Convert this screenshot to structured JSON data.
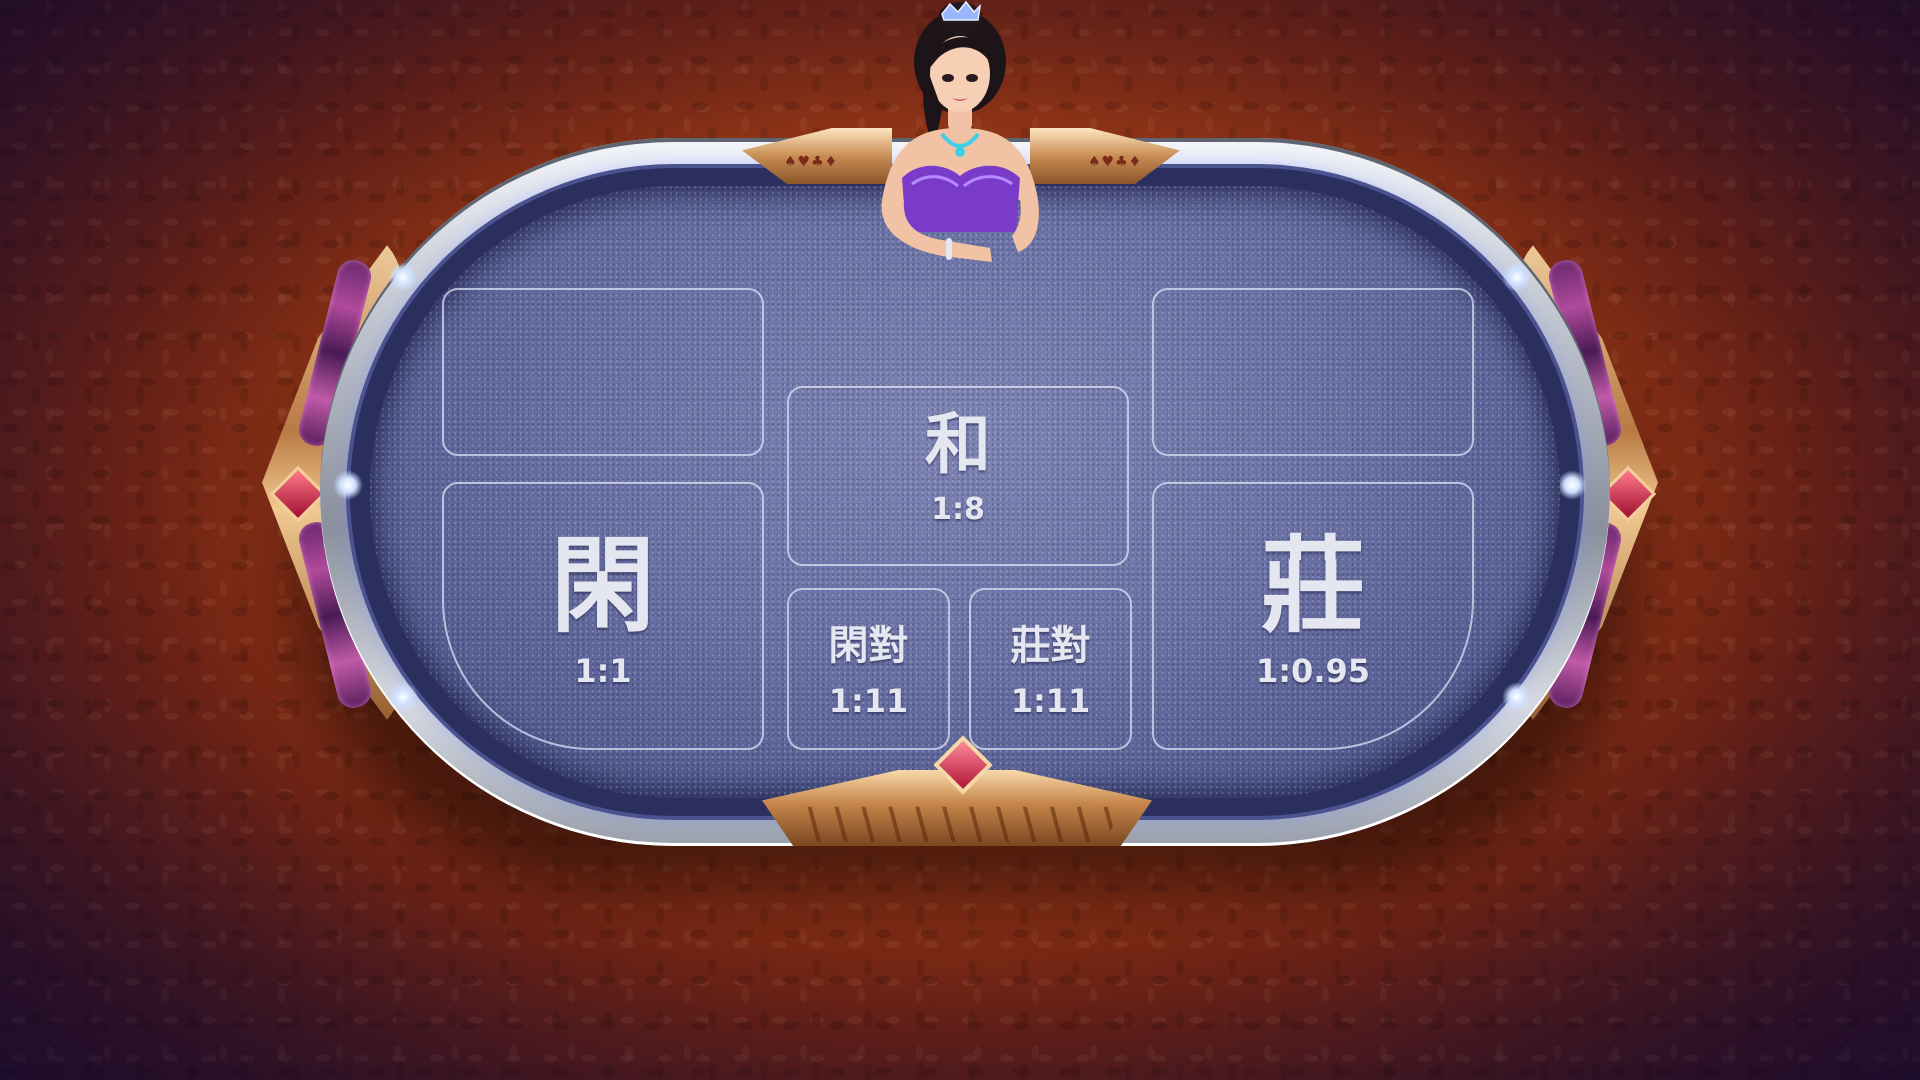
{
  "table": {
    "bets": {
      "tie": {
        "label": "和",
        "odds": "1:8"
      },
      "player": {
        "label": "閑",
        "odds": "1:1"
      },
      "banker": {
        "label": "莊",
        "odds": "1:0.95"
      },
      "player_pair": {
        "label": "閑對",
        "odds": "1:11"
      },
      "banker_pair": {
        "label": "莊對",
        "odds": "1:11"
      }
    }
  },
  "colors": {
    "background": "#9a3a18",
    "felt": "#6b72a6",
    "rim": "#b9bec8",
    "gold": "#c98d55",
    "jewel": "#b01535",
    "text": "#e4e6f0"
  },
  "icons": {
    "dealer": "dealer-avatar",
    "suits": "card-suits-icon",
    "jewel": "diamond-jewel-icon"
  }
}
